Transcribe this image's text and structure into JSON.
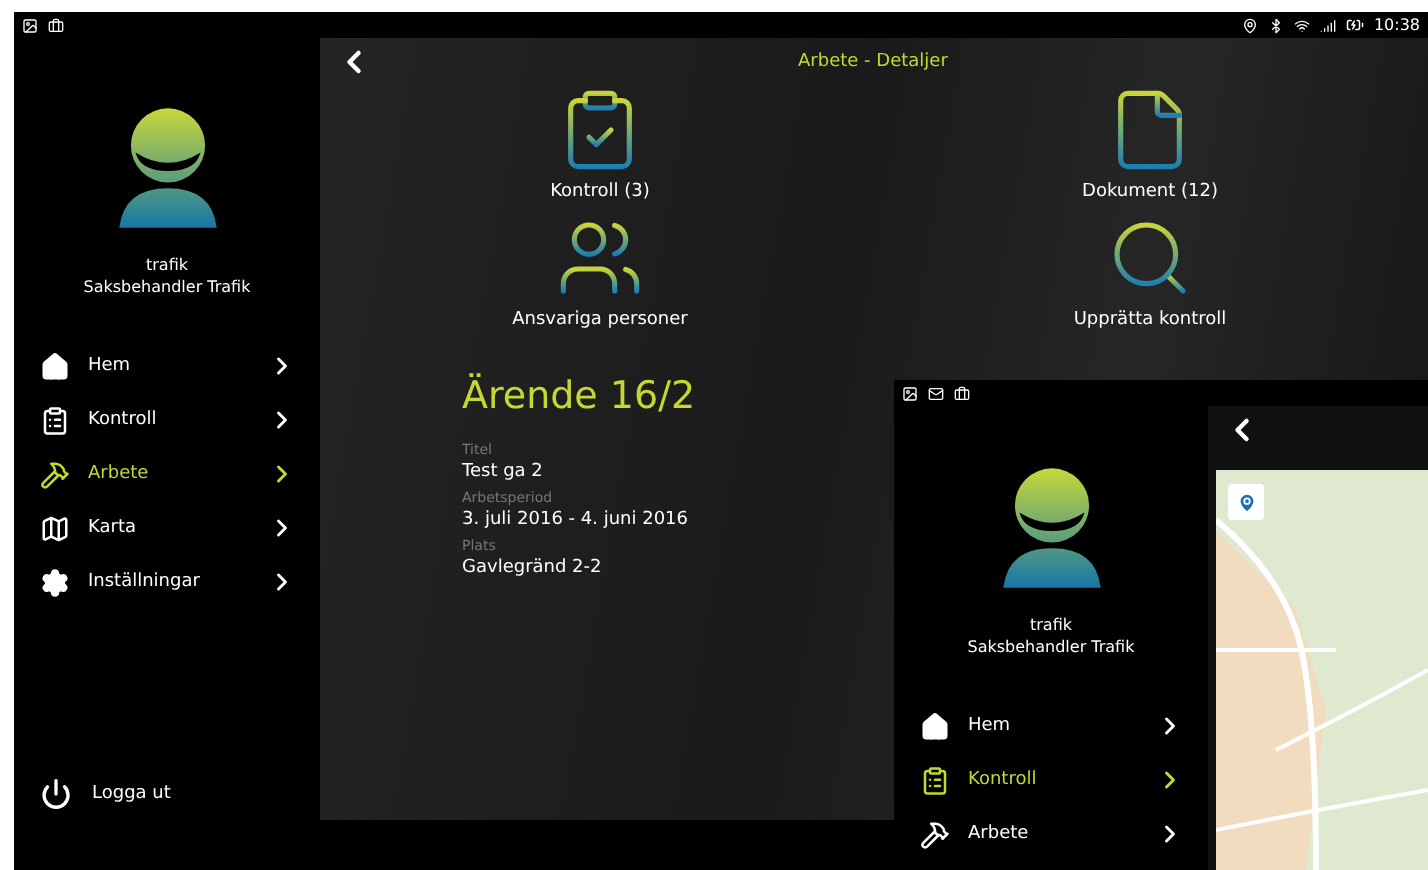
{
  "status_bar": {
    "time": "10:38"
  },
  "sidebar": {
    "user": {
      "name": "trafik",
      "role": "Saksbehandler Trafik"
    },
    "items": [
      {
        "kind": "home",
        "label": "Hem",
        "selected": false
      },
      {
        "kind": "clipboard",
        "label": "Kontroll",
        "selected": false
      },
      {
        "kind": "hammer",
        "label": "Arbete",
        "selected": true
      },
      {
        "kind": "map",
        "label": "Karta",
        "selected": false
      },
      {
        "kind": "settings",
        "label": "Inställningar",
        "selected": false
      }
    ],
    "logout": "Logga ut"
  },
  "header": {
    "title": "Arbete - Detaljer"
  },
  "tiles": [
    {
      "kind": "checklist",
      "label": "Kontroll (3)"
    },
    {
      "kind": "document",
      "label": "Dokument (12)"
    },
    {
      "kind": "people",
      "label": "Ansvariga personer"
    },
    {
      "kind": "inspect",
      "label": "Upprätta kontroll"
    }
  ],
  "case": {
    "title": "Ärende 16/2",
    "fields": [
      {
        "label": "Titel",
        "value": "Test ga 2"
      },
      {
        "label": "Arbetsperiod",
        "value": "3. juli 2016 - 4. juni 2016"
      },
      {
        "label": "Plats",
        "value": "Gavlegränd 2-2"
      }
    ]
  },
  "overlay_screen": {
    "sidebar": {
      "user": {
        "name": "trafik",
        "role": "Saksbehandler Trafik"
      },
      "items": [
        {
          "kind": "home",
          "label": "Hem",
          "selected": false
        },
        {
          "kind": "clipboard",
          "label": "Kontroll",
          "selected": true
        },
        {
          "kind": "hammer",
          "label": "Arbete",
          "selected": false
        }
      ]
    }
  }
}
